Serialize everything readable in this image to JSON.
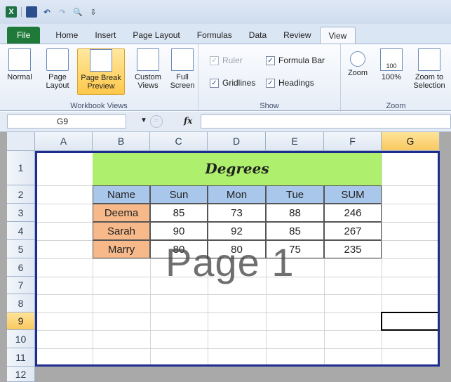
{
  "qat": {
    "app_icon": "excel-logo-icon",
    "items": [
      "save-icon",
      "undo-icon",
      "redo-icon",
      "print-preview-icon",
      "customize-icon"
    ],
    "logo_text": "X",
    "undo_glyph": "↶",
    "redo_glyph": "↷",
    "preview_glyph": "🔍",
    "customize_glyph": "⇩"
  },
  "tabs": [
    {
      "label": "File"
    },
    {
      "label": "Home"
    },
    {
      "label": "Insert"
    },
    {
      "label": "Page Layout"
    },
    {
      "label": "Formulas"
    },
    {
      "label": "Data"
    },
    {
      "label": "Review"
    },
    {
      "label": "View"
    }
  ],
  "active_tab": "View",
  "ribbon": {
    "workbook_views": {
      "label": "Workbook Views",
      "buttons": [
        {
          "label": "Normal"
        },
        {
          "label": "Page Layout"
        },
        {
          "label": "Page Break Preview"
        },
        {
          "label": "Custom Views"
        },
        {
          "label": "Full Screen"
        }
      ]
    },
    "show": {
      "label": "Show",
      "ruler": "Ruler",
      "formula_bar": "Formula Bar",
      "gridlines": "Gridlines",
      "headings": "Headings",
      "check_glyph": "✓"
    },
    "zoom": {
      "label": "Zoom",
      "zoom_btn": "Zoom",
      "hundred_btn": "100%",
      "selection_btn": "Zoom to Selection",
      "hundred_icon_text": "100"
    }
  },
  "formula_bar": {
    "name_box": "G9",
    "fx_label": "fx",
    "formula": "",
    "dropdown_glyph": "▼",
    "fx_circle_glyph": "="
  },
  "columns": [
    "A",
    "B",
    "C",
    "D",
    "E",
    "F",
    "G"
  ],
  "rows": [
    "1",
    "2",
    "3",
    "4",
    "5",
    "6",
    "7",
    "8",
    "9",
    "10",
    "11",
    "12"
  ],
  "selected_cell": "G9",
  "table": {
    "title": "Degrees",
    "headers": [
      "Name",
      "Sun",
      "Mon",
      "Tue",
      "SUM"
    ],
    "rows": [
      [
        "Deema",
        "85",
        "73",
        "88",
        "246"
      ],
      [
        "Sarah",
        "90",
        "92",
        "85",
        "267"
      ],
      [
        "Marry",
        "80",
        "80",
        "75",
        "235"
      ]
    ]
  },
  "watermark": "Page 1",
  "colors": {
    "title_bg": "#aef06e",
    "header_bg": "#a9c7ea",
    "name_bg": "#f7b98a",
    "page_border": "#1e2b8f",
    "file_tab": "#1f7a3a"
  }
}
